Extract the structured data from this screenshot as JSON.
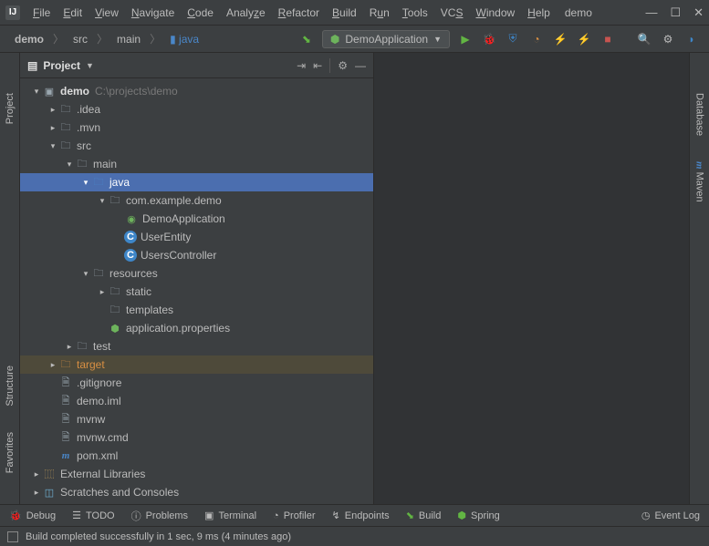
{
  "window": {
    "project_label": "demo"
  },
  "menu": {
    "items": [
      "File",
      "Edit",
      "View",
      "Navigate",
      "Code",
      "Analyze",
      "Refactor",
      "Build",
      "Run",
      "Tools",
      "VCS",
      "Window",
      "Help"
    ]
  },
  "breadcrumbs": {
    "items": [
      "demo",
      "src",
      "main",
      "java"
    ]
  },
  "run_config": {
    "label": "DemoApplication"
  },
  "panel": {
    "title": "Project"
  },
  "tree": {
    "root": {
      "name": "demo",
      "path": "C:\\projects\\demo"
    },
    "idea": ".idea",
    "mvn": ".mvn",
    "src": "src",
    "main": "main",
    "java": "java",
    "package": "com.example.demo",
    "classes": [
      "DemoApplication",
      "UserEntity",
      "UsersController"
    ],
    "resources": "resources",
    "static": "static",
    "templates": "templates",
    "appprops": "application.properties",
    "test": "test",
    "target": "target",
    "gitignore": ".gitignore",
    "iml": "demo.iml",
    "mvnw": "mvnw",
    "mvnwcmd": "mvnw.cmd",
    "pom": "pom.xml",
    "external": "External Libraries",
    "scratches": "Scratches and Consoles"
  },
  "left_tabs": {
    "project": "Project",
    "structure": "Structure",
    "favorites": "Favorites"
  },
  "right_tabs": {
    "database": "Database",
    "maven": "Maven"
  },
  "bottom": {
    "debug": "Debug",
    "todo": "TODO",
    "problems": "Problems",
    "terminal": "Terminal",
    "profiler": "Profiler",
    "endpoints": "Endpoints",
    "build": "Build",
    "spring": "Spring",
    "eventlog": "Event Log"
  },
  "status": {
    "message": "Build completed successfully in 1 sec, 9 ms (4 minutes ago)"
  }
}
